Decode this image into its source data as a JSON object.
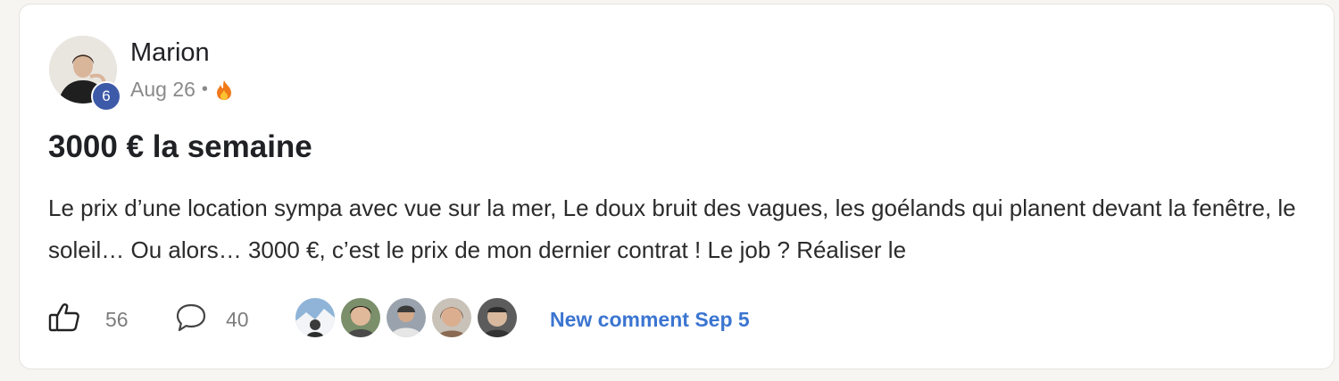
{
  "post": {
    "author": {
      "name": "Marion",
      "level": "6",
      "avatar_icon": "user-avatar-photo"
    },
    "meta": {
      "date": "Aug 26",
      "separator": "•",
      "badge_icon": "flame-icon"
    },
    "title": "3000 € la semaine",
    "excerpt": "Le prix d’une location sympa avec vue sur la mer, Le doux bruit des vagues, les goélands qui planent devant la fenêtre, le soleil… Ou alors… 3000 €, c’est le prix de mon dernier contrat ! Le job ? Réaliser le"
  },
  "actions": {
    "like_icon": "thumbs-up-icon",
    "likes": "56",
    "comment_icon": "comment-bubble-icon",
    "comments": "40",
    "recent_commenters_count": 5,
    "new_comment_label": "New comment Sep 5"
  },
  "colors": {
    "level_badge": "#3d5aa8",
    "link": "#3b75d1",
    "muted_text": "#7d7d7d",
    "card_background": "#ffffff",
    "page_background": "#f6f5f2"
  }
}
